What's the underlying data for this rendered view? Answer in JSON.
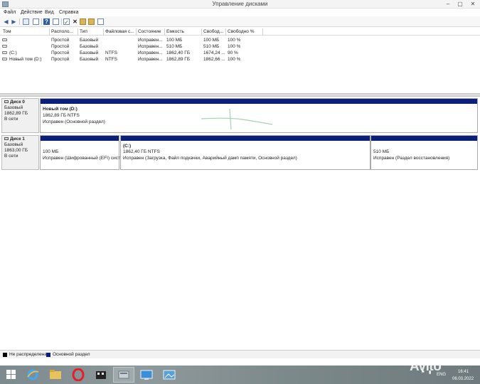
{
  "window": {
    "title": "Управление дисками"
  },
  "menu": [
    "Файл",
    "Действие",
    "Вид",
    "Справка"
  ],
  "toolbar": {
    "buttons": [
      "back-icon",
      "forward-icon",
      "console-tree-icon",
      "view-icon",
      "help-icon",
      "properties-icon",
      "properties-sheet-icon",
      "delete-icon",
      "open-icon",
      "explore-icon",
      "properties-small-icon"
    ]
  },
  "volume_list": {
    "columns": [
      "Том",
      "Располо...",
      "Тип",
      "Файловая с...",
      "Состояние",
      "Емкость",
      "Свобод...",
      "Свободно %"
    ],
    "rows": [
      {
        "vol": "",
        "layout": "Простой",
        "type": "Базовый",
        "fs": "",
        "status": "Исправен...",
        "capacity": "100 МБ",
        "free": "100 МБ",
        "pct": "100 %"
      },
      {
        "vol": "",
        "layout": "Простой",
        "type": "Базовый",
        "fs": "",
        "status": "Исправен...",
        "capacity": "510 МБ",
        "free": "510 МБ",
        "pct": "100 %"
      },
      {
        "vol": "(C:)",
        "layout": "Простой",
        "type": "Базовый",
        "fs": "NTFS",
        "status": "Исправен...",
        "capacity": "1862,40 ГБ",
        "free": "1674,24 ...",
        "pct": "90 %"
      },
      {
        "vol": "Новый том (D:)",
        "layout": "Простой",
        "type": "Базовый",
        "fs": "NTFS",
        "status": "Исправен...",
        "capacity": "1862,89 ГБ",
        "free": "1862,66 ...",
        "pct": "100 %"
      }
    ]
  },
  "disks": [
    {
      "name": "Диск 0",
      "type": "Базовый",
      "size": "1862,89 ГБ",
      "state": "В сети",
      "partitions": [
        {
          "title": "Новый том (D:)",
          "size": "1862,89 ГБ NTFS",
          "status": "Исправен (Основной раздел)"
        }
      ]
    },
    {
      "name": "Диск 1",
      "type": "Базовый",
      "size": "1863,00 ГБ",
      "state": "В сети",
      "partitions": [
        {
          "title": "",
          "size": "100 МБ",
          "status": "Исправен (Шифрованный (EFI) сист"
        },
        {
          "title": "(C:)",
          "size": "1862,40 ГБ NTFS",
          "status": "Исправен (Загрузка, Файл подкачки, Аварийный дамп памяти, Основной раздел)"
        },
        {
          "title": "",
          "size": "510 МБ",
          "status": "Исправен (Раздел восстановления)"
        }
      ]
    }
  ],
  "legend": [
    {
      "label": "Не распределена",
      "color": "#000000"
    },
    {
      "label": "Основной раздел",
      "color": "#0a1f7a"
    }
  ],
  "taskbar": {
    "apps": [
      "ie-icon",
      "file-explorer-icon",
      "opera-icon",
      "media-icon",
      "disk-management-icon",
      "remote-desktop-icon",
      "image-viewer-icon"
    ],
    "lang": "ENG",
    "time": "16:41",
    "date": "06.03.2022"
  },
  "watermark": "Avito"
}
